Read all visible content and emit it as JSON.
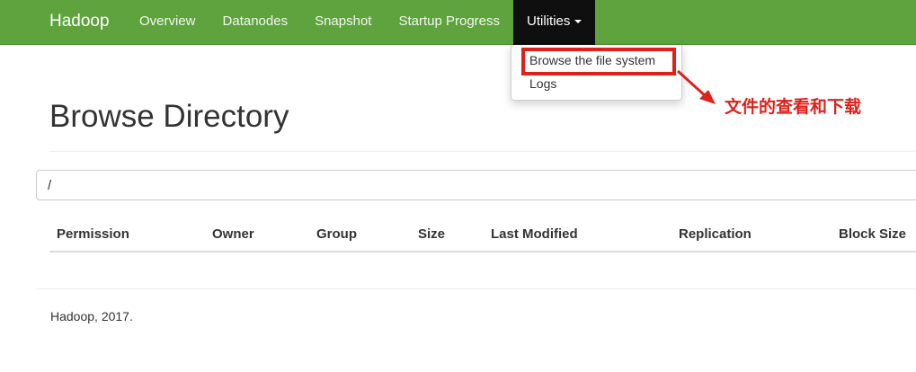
{
  "navbar": {
    "brand": "Hadoop",
    "items": [
      {
        "label": "Overview"
      },
      {
        "label": "Datanodes"
      },
      {
        "label": "Snapshot"
      },
      {
        "label": "Startup Progress"
      },
      {
        "label": "Utilities"
      }
    ],
    "background_color": "#5fa33e",
    "active_color": "#0f0f0f"
  },
  "dropdown": {
    "items": [
      {
        "label": "Browse the file system",
        "highlighted": true
      },
      {
        "label": "Logs",
        "highlighted": false
      }
    ]
  },
  "annotation": {
    "text": "文件的查看和下载",
    "color": "#e0201a"
  },
  "main": {
    "title": "Browse Directory",
    "path_value": "/",
    "table": {
      "headers": [
        "Permission",
        "Owner",
        "Group",
        "Size",
        "Last Modified",
        "Replication",
        "Block Size"
      ],
      "rows": []
    }
  },
  "footer": {
    "text": "Hadoop, 2017."
  }
}
